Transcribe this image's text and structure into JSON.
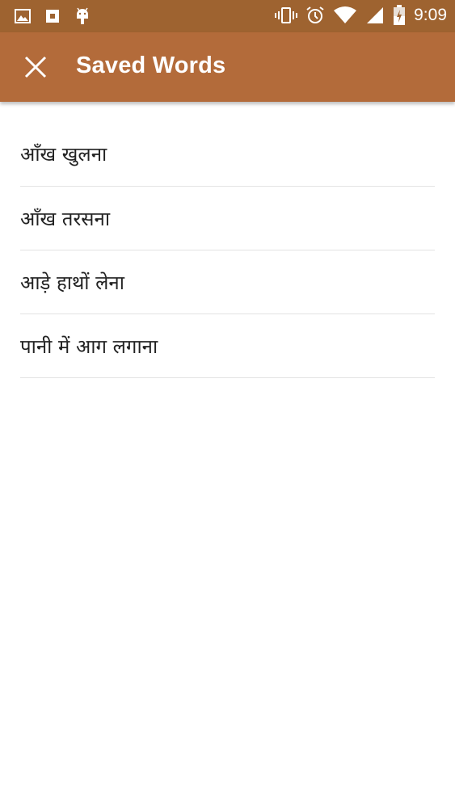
{
  "status_bar": {
    "time": "9:09",
    "left_icons": [
      "image-icon",
      "camera-icon",
      "android-icon"
    ],
    "right_icons": [
      "vibrate-icon",
      "alarm-icon",
      "wifi-icon",
      "signal-icon",
      "battery-icon"
    ]
  },
  "app_bar": {
    "title": "Saved Words",
    "close_icon": "close-icon",
    "color": "#b36b3a"
  },
  "words": [
    {
      "text": "आँख खुलना"
    },
    {
      "text": "आँख तरसना"
    },
    {
      "text": "आड़े हाथों लेना"
    },
    {
      "text": "पानी में आग लगाना"
    }
  ]
}
